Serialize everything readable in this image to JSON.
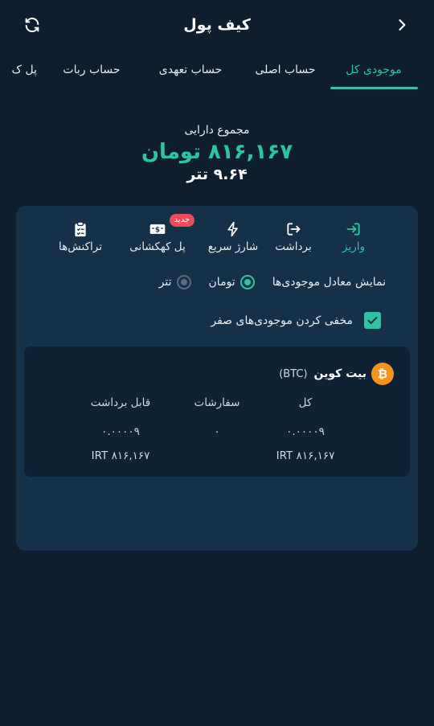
{
  "header": {
    "title": "کیف پول",
    "refresh_icon": "refresh-icon",
    "back_icon": "chevron-right-icon"
  },
  "tabs": [
    {
      "label": "موجودی کل",
      "active": true
    },
    {
      "label": "حساب اصلی",
      "active": false
    },
    {
      "label": "حساب تعهدی",
      "active": false
    },
    {
      "label": "حساب ربات",
      "active": false
    },
    {
      "label": "پل ک",
      "active": false
    }
  ],
  "summary": {
    "label": "مجموع دارایی",
    "main_value": "۸۱۶,۱۶۷ تومان",
    "sub_value": "۹.۶۴ تتر"
  },
  "actions": {
    "deposit": "واریز",
    "withdraw": "برداشت",
    "quick_charge": "شارژ سریع",
    "galaxy_bridge": "پل کهکشانی",
    "new_badge": "جدید",
    "transactions": "تراکنش‌ها"
  },
  "display_options": {
    "label": "نمایش معادل موجودی‌ها",
    "option_toman": "تومان",
    "option_tether": "تتر",
    "selected": "تومان"
  },
  "hide_zero": {
    "label": "مخفی کردن موجودی‌های صفر",
    "checked": true
  },
  "asset": {
    "name": "بیت کوین",
    "symbol": "(BTC)",
    "columns": {
      "total": "کل",
      "orders": "سفارشات",
      "withdrawable": "قابل برداشت"
    },
    "total_amount": "۰.۰۰۰۰۹",
    "total_irt": "۸۱۶,۱۶۷ IRT",
    "orders_amount": "۰",
    "withdrawable_amount": "۰.۰۰۰۰۹",
    "withdrawable_irt": "۸۱۶,۱۶۷ IRT"
  },
  "colors": {
    "background": "#0e1e2e",
    "panel": "#15314a",
    "accent": "#2fc3a3",
    "badge": "#ef4a5a",
    "bitcoin": "#f7931a"
  }
}
